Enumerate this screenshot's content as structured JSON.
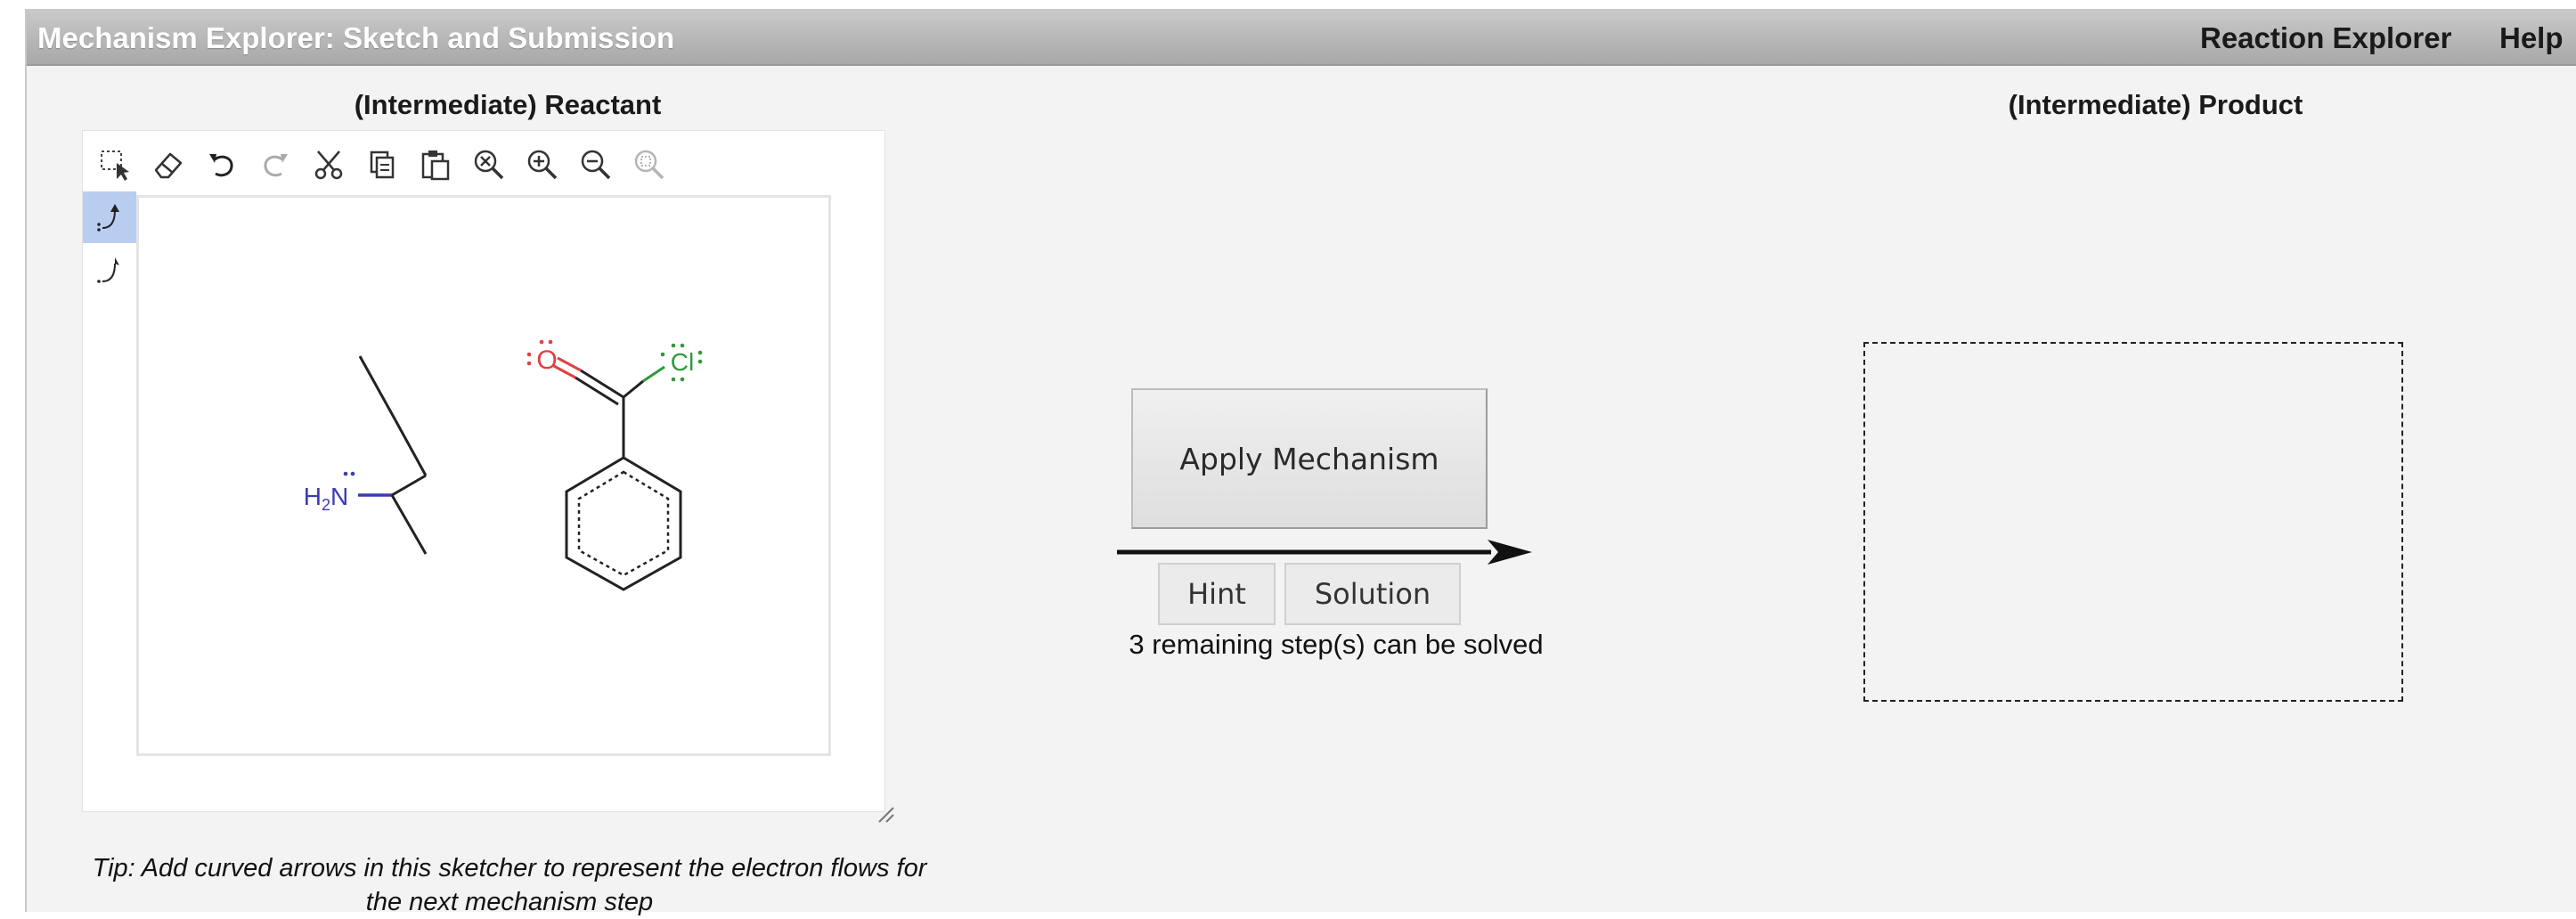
{
  "header": {
    "app_title": "Mechanism Explorer: Sketch and Submission",
    "nav": [
      {
        "label": "Reaction Explorer"
      },
      {
        "label": "Help"
      }
    ]
  },
  "reactant_panel": {
    "heading": "(Intermediate) Reactant",
    "toolbar": [
      {
        "icon": "select-rectangle-icon"
      },
      {
        "icon": "eraser-icon"
      },
      {
        "icon": "undo-icon"
      },
      {
        "icon": "redo-icon"
      },
      {
        "icon": "cut-icon"
      },
      {
        "icon": "copy-icon"
      },
      {
        "icon": "paste-icon"
      },
      {
        "icon": "zoom-reset-icon"
      },
      {
        "icon": "zoom-in-icon"
      },
      {
        "icon": "zoom-out-icon"
      },
      {
        "icon": "zoom-fit-icon"
      }
    ],
    "side_tools": [
      {
        "icon": "electron-pair-arrow-icon",
        "active": true
      },
      {
        "icon": "single-electron-arrow-icon",
        "active": false
      }
    ],
    "molecules": {
      "amine_label": "H2N",
      "amine_sub": "2",
      "oxygen_label": "O",
      "chlorine_label": "Cl"
    },
    "tip": "Tip: Add curved arrows in this sketcher to represent the electron flows for the next mechanism step"
  },
  "actions": {
    "apply_label": "Apply Mechanism",
    "hint_label": "Hint",
    "solution_label": "Solution",
    "remaining_text": "3 remaining step(s) can be solved"
  },
  "product_panel": {
    "heading": "(Intermediate) Product"
  },
  "colors": {
    "nitrogen": "#3b3bb3",
    "oxygen": "#e04040",
    "chlorine": "#2f9a3a",
    "active_tool": "#b9cdf0"
  }
}
